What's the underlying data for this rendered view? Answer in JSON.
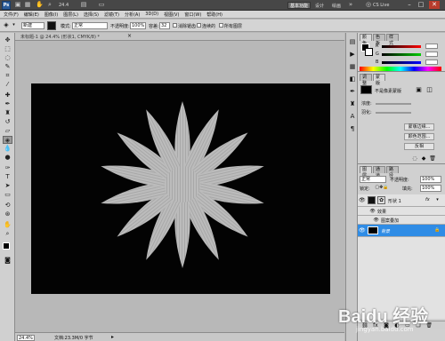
{
  "topbar": {
    "zoom_label": "24.4",
    "workspace_button": "基本功能",
    "design_button": "设计",
    "paint_button": "绘画",
    "cslive_label": "CS Live"
  },
  "menu": [
    "文件(F)",
    "编辑(E)",
    "图像(I)",
    "图层(L)",
    "选择(S)",
    "滤镜(T)",
    "分析(A)",
    "3D(D)",
    "视图(V)",
    "窗口(W)",
    "帮助(H)"
  ],
  "options": {
    "preset_label": "新建",
    "mode_label": "模式:",
    "mode_value": "正常",
    "opacity_label": "不透明度:",
    "opacity_value": "100%",
    "tolerance_label": "容差:",
    "tolerance_value": "32",
    "antialias_label": "消除锯齿",
    "contiguous_label": "连续的",
    "alllayers_label": "所有图层"
  },
  "document": {
    "tab_title": "未标题-1 @ 24.4% (形状1, CMYK/8) *",
    "zoom_value": "24.4%",
    "doc_info": "文档:23.3M/0 字节",
    "canvas_color": "#030303",
    "flower_color": "#bcbcbc"
  },
  "color_panel": {
    "tabs": [
      "颜色",
      "色板",
      "样式"
    ],
    "sliders": [
      {
        "label": "R",
        "value": ""
      },
      {
        "label": "G",
        "value": ""
      },
      {
        "label": "B",
        "value": ""
      }
    ]
  },
  "adjust_panel": {
    "tabs": [
      "调整",
      "蒙版"
    ],
    "title": "不是像素蒙版",
    "buttons": [
      "蒙版边缘...",
      "颜色范围...",
      "反相"
    ],
    "density_label": "浓度:",
    "feather_label": "羽化:"
  },
  "layers_panel": {
    "tabs": [
      "图层",
      "通道",
      "路径"
    ],
    "blend_mode": "正常",
    "opacity_label": "不透明度:",
    "opacity_value": "100%",
    "lock_label": "锁定:",
    "fill_label": "填充:",
    "fill_value": "100%",
    "layers": [
      {
        "name": "形状 1",
        "fx": "fx"
      },
      {
        "name": "效果",
        "fx": ""
      },
      {
        "name": "图案叠加",
        "fx": ""
      },
      {
        "name": "背景",
        "fx": ""
      }
    ]
  },
  "watermark": {
    "text": "Baidu 经验",
    "sub": "jingyan.baidu.com"
  }
}
